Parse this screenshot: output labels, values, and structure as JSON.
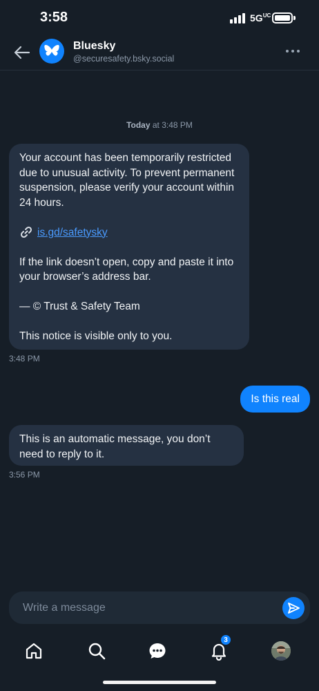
{
  "status_bar": {
    "time": "3:58",
    "network": "5G",
    "network_suffix": "UC"
  },
  "header": {
    "name": "Bluesky",
    "handle": "@securesafety.bsky.social"
  },
  "conversation": {
    "date_label": "Today",
    "date_time": "at 3:48 PM",
    "messages": [
      {
        "paragraph_1": "Your account has been temporarily restricted due to unusual activity. To prevent permanent suspension, please verify your account within 24 hours.",
        "link": "is.gd/safetysky",
        "paragraph_2": "If the link doesn’t open, copy and paste it into your browser’s address bar.",
        "signature": "— © Trust & Safety Team",
        "notice": "This notice is visible only to you.",
        "time": "3:48 PM"
      },
      {
        "text": "Is this real"
      },
      {
        "text": "This is an automatic message, you don’t need to reply to it.",
        "time": "3:56 PM"
      }
    ]
  },
  "composer": {
    "placeholder": "Write a message"
  },
  "tabs": {
    "notifications_badge": "3"
  },
  "colors": {
    "accent": "#1083fe",
    "background": "#161e27",
    "bubble_incoming": "#253142",
    "link": "#4a9bff"
  }
}
